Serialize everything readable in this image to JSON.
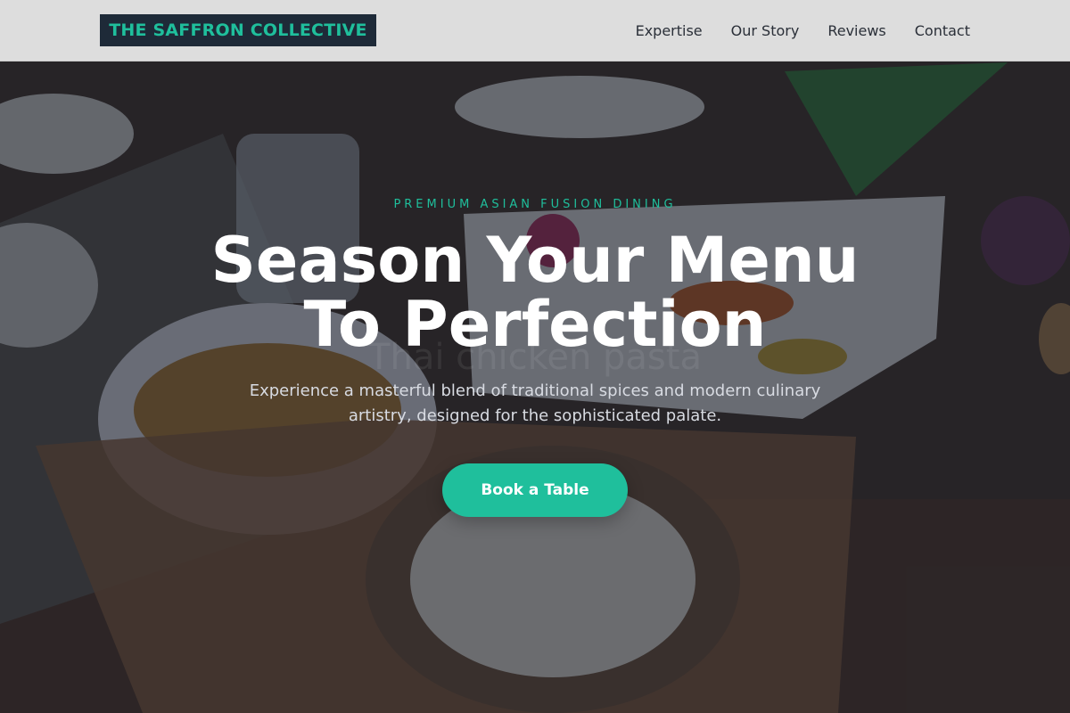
{
  "header": {
    "logo_text": "THE SAFFRON COLLECTIVE",
    "nav": [
      {
        "label": "Expertise"
      },
      {
        "label": "Our Story"
      },
      {
        "label": "Reviews"
      },
      {
        "label": "Contact"
      }
    ]
  },
  "hero": {
    "eyebrow": "PREMIUM ASIAN FUSION DINING",
    "headline_line1": "Season Your Menu",
    "headline_line2": "To Perfection",
    "ghost_text": "Thai chicken pasta",
    "subhead": "Experience a masterful blend of traditional spices and modern culinary artistry, designed for the sophisticated palate.",
    "cta_label": "Book a Table",
    "background_image": "asian-food-table-photo"
  },
  "colors": {
    "accent": "#1fbf9c",
    "logo_bg": "#1e2a38",
    "header_bg": "#ececec",
    "overlay": "#1c202c"
  }
}
